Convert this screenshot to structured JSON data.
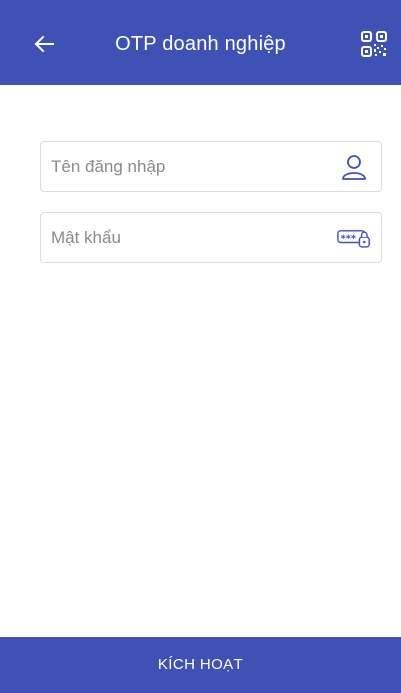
{
  "header": {
    "title": "OTP doanh nghiệp",
    "back_icon": "arrow-left-icon",
    "qr_icon": "qr-code-icon"
  },
  "form": {
    "username": {
      "value": "",
      "placeholder": "Tên đăng nhập",
      "icon": "user-icon"
    },
    "password": {
      "value": "",
      "placeholder": "Mật khẩu",
      "icon": "password-lock-icon"
    }
  },
  "footer": {
    "activate_label": "KÍCH HOẠT"
  },
  "colors": {
    "primary": "#3f51b5",
    "field_border": "#dcdcdc",
    "placeholder": "#8a8a8a"
  }
}
